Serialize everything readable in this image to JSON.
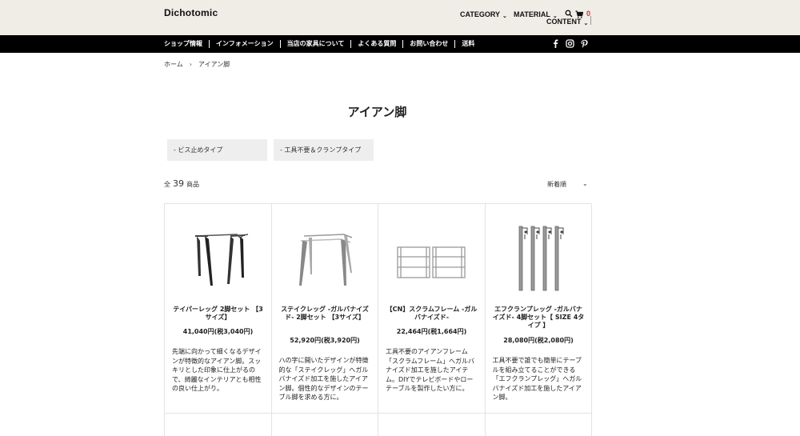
{
  "header": {
    "logo": "Dichotomic",
    "nav": {
      "category": "CATEGORY",
      "material": "MATERIAL",
      "content": "CONTENT"
    },
    "cart_count": "0"
  },
  "navbar": {
    "items": [
      "ショップ情報",
      "インフォメーション",
      "当店の家具について",
      "よくある質問",
      "お問い合わせ",
      "送料"
    ]
  },
  "breadcrumb": {
    "home": "ホーム",
    "current": "アイアン脚"
  },
  "page": {
    "title": "アイアン脚",
    "filters": [
      "- ビス止めタイプ",
      "- 工具不要＆クランプタイプ"
    ],
    "count_prefix": "全",
    "count": "39",
    "count_suffix": "商品",
    "sort": "新着順"
  },
  "products": [
    {
      "name": "テイパーレッグ 2脚セット 【3サイズ】",
      "price": "41,040円(税3,040円)",
      "desc": "先端に向かって細くなるデザインが特徴的なアイアン脚。スッキリとした印象に仕上がるので、綺麗なインテリアとも相性の良い仕上がり。"
    },
    {
      "name": "ステイクレッグ -ガルバナイズド- 2脚セット 【3サイズ】",
      "price": "52,920円(税3,920円)",
      "desc": "ハの字に開いたデザインが特徴的な「ステイクレッグ」へガルバナイズド加工を施したアイアン脚。個性的なデザインのテーブル脚を求める方に。"
    },
    {
      "name": "【CN】スクラムフレーム -ガルバナイズド-",
      "price": "22,464円(税1,664円)",
      "desc": "工具不要のアイアンフレーム「スクラムフレーム」へガルバナイズド加工を施したアイテム。DIYでテレビボードやローテーブルを製作したい方に。"
    },
    {
      "name": "エフクランプレッグ -ガルバナイズド- 4脚セット【 SIZE 4タイプ 】",
      "price": "28,080円(税2,080円)",
      "desc": "工具不要で誰でも簡単にテーブルを組み立てることができる「エフクランプレッグ」へガルバナイズド加工を施したアイアン脚。"
    }
  ]
}
